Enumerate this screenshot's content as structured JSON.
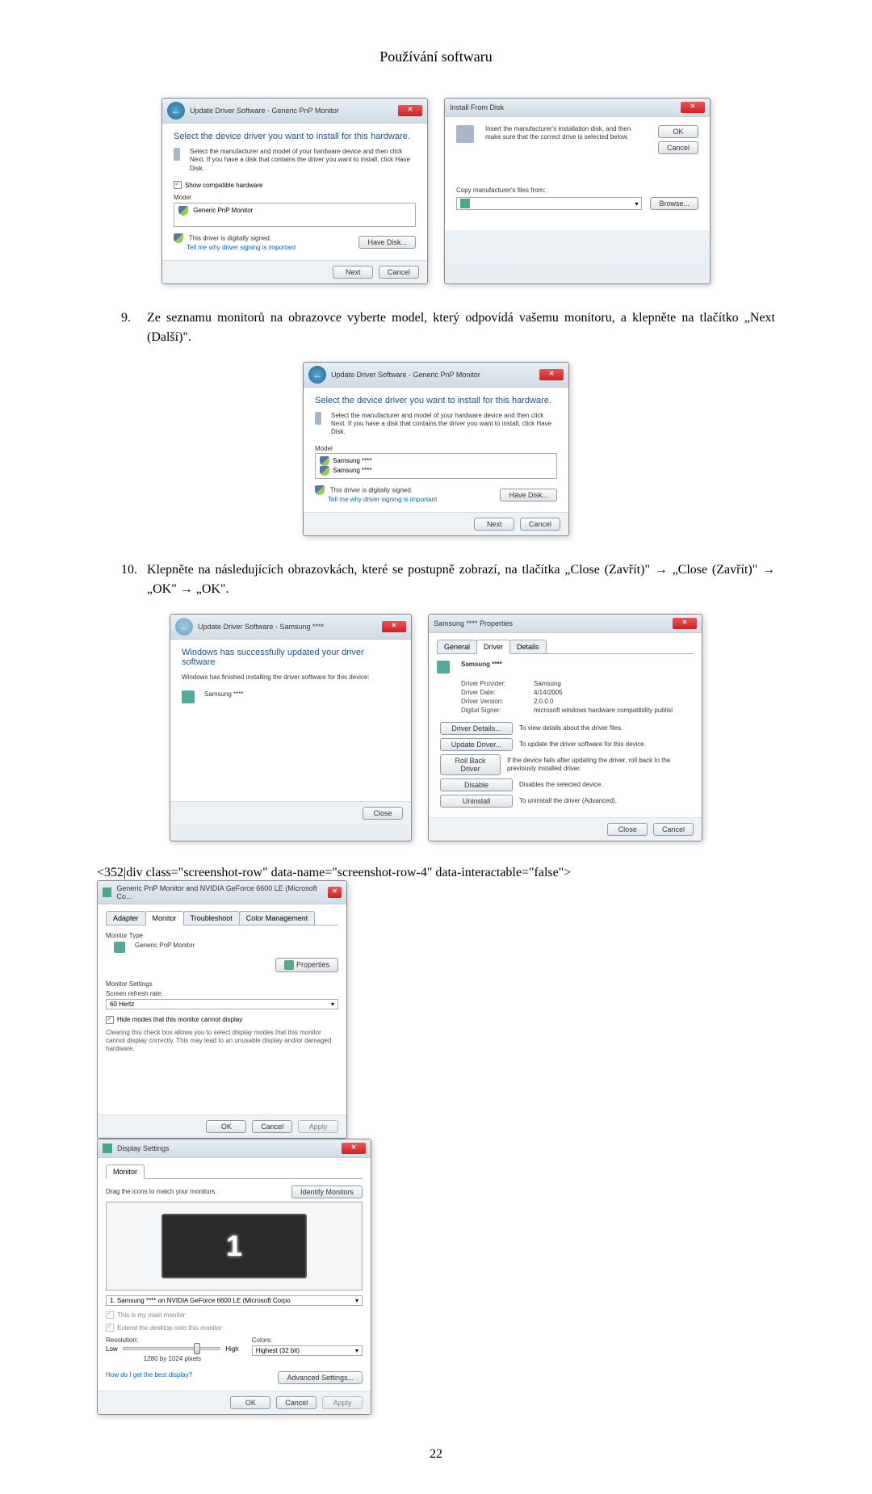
{
  "header": {
    "title": "Používání softwaru"
  },
  "step9": {
    "num": "9.",
    "text": "Ze seznamu monitorů na obrazovce vyberte model, který odpovídá vašemu monitoru, a klepněte na tlačítko „Next (Další)\"."
  },
  "step10": {
    "num": "10.",
    "text": "Klepněte na následujících obrazovkách, které se postupně zobrazí, na tlačítka „Close (Zavřít)\" → „Close (Zavřít)\" → „OK\" → „OK\"."
  },
  "dlg1": {
    "title": "Update Driver Software - Generic PnP Monitor",
    "heading": "Select the device driver you want to install for this hardware.",
    "desc": "Select the manufacturer and model of your hardware device and then click Next. If you have a disk that contains the driver you want to install, click Have Disk.",
    "check": "Show compatible hardware",
    "model_label": "Model",
    "model_item": "Generic PnP Monitor",
    "signed": "This driver is digitally signed.",
    "signed_link": "Tell me why driver signing is important",
    "have_disk": "Have Disk...",
    "next": "Next",
    "cancel": "Cancel"
  },
  "dlg2": {
    "title": "Install From Disk",
    "desc": "Insert the manufacturer's installation disk, and then make sure that the correct drive is selected below.",
    "ok": "OK",
    "cancel": "Cancel",
    "copy_label": "Copy manufacturer's files from:",
    "browse": "Browse..."
  },
  "dlg3": {
    "title": "Update Driver Software - Generic PnP Monitor",
    "heading": "Select the device driver you want to install for this hardware.",
    "desc": "Select the manufacturer and model of your hardware device and then click Next. If you have a disk that contains the driver you want to install, click Have Disk.",
    "model_label": "Model",
    "model_item1": "Samsung ****",
    "model_item2": "Samsung ****",
    "signed": "This driver is digitally signed.",
    "signed_link": "Tell me why driver signing is important",
    "have_disk": "Have Disk...",
    "next": "Next",
    "cancel": "Cancel"
  },
  "dlg4": {
    "title": "Update Driver Software - Samsung ****",
    "heading": "Windows has successfully updated your driver software",
    "desc": "Windows has finished installing the driver software for this device:",
    "device": "Samsung ****",
    "close": "Close"
  },
  "dlg5": {
    "title": "Samsung **** Properties",
    "tab_general": "General",
    "tab_driver": "Driver",
    "tab_details": "Details",
    "device": "Samsung ****",
    "provider_lbl": "Driver Provider:",
    "provider_val": "Samsung",
    "date_lbl": "Driver Date:",
    "date_val": "4/14/2005",
    "version_lbl": "Driver Version:",
    "version_val": "2.0.0.0",
    "signer_lbl": "Digital Signer:",
    "signer_val": "microsoft windows hardware compatibility publisl",
    "btn_details": "Driver Details...",
    "btn_details_desc": "To view details about the driver files.",
    "btn_update": "Update Driver...",
    "btn_update_desc": "To update the driver software for this device.",
    "btn_rollback": "Roll Back Driver",
    "btn_rollback_desc": "If the device fails after updating the driver, roll back to the previously installed driver.",
    "btn_disable": "Disable",
    "btn_disable_desc": "Disables the selected device.",
    "btn_uninstall": "Uninstall",
    "btn_uninstall_desc": "To uninstall the driver (Advanced).",
    "close": "Close",
    "cancel": "Cancel"
  },
  "dlg6": {
    "title": "Generic PnP Monitor and NVIDIA GeForce 6600 LE (Microsoft Co...",
    "tab_adapter": "Adapter",
    "tab_monitor": "Monitor",
    "tab_trouble": "Troubleshoot",
    "tab_color": "Color Management",
    "type_label": "Monitor Type",
    "type_val": "Generic PnP Monitor",
    "properties": "Properties",
    "settings_label": "Monitor Settings",
    "refresh_label": "Screen refresh rate:",
    "refresh_val": "60 Hertz",
    "hide_check": "Hide modes that this monitor cannot display",
    "hide_desc": "Clearing this check box allows you to select display modes that this monitor cannot display correctly. This may lead to an unusable display and/or damaged hardware.",
    "ok": "OK",
    "cancel": "Cancel",
    "apply": "Apply"
  },
  "dlg7": {
    "title": "Display Settings",
    "tab_monitor": "Monitor",
    "drag_text": "Drag the icons to match your monitors.",
    "identify": "Identify Monitors",
    "monitor_num": "1",
    "monitor_select": "1. Samsung **** on NVIDIA GeForce 6600 LE (Microsoft Corpo",
    "main_check": "This is my main monitor",
    "extend_check": "Extend the desktop onto this monitor",
    "resolution_label": "Resolution:",
    "res_low": "Low",
    "res_high": "High",
    "res_val": "1280 by 1024 pixels",
    "colors_label": "Colors:",
    "colors_val": "Highest (32 bit)",
    "help_link": "How do I get the best display?",
    "advanced": "Advanced Settings...",
    "ok": "OK",
    "cancel": "Cancel",
    "apply": "Apply"
  },
  "pagenum": "22"
}
